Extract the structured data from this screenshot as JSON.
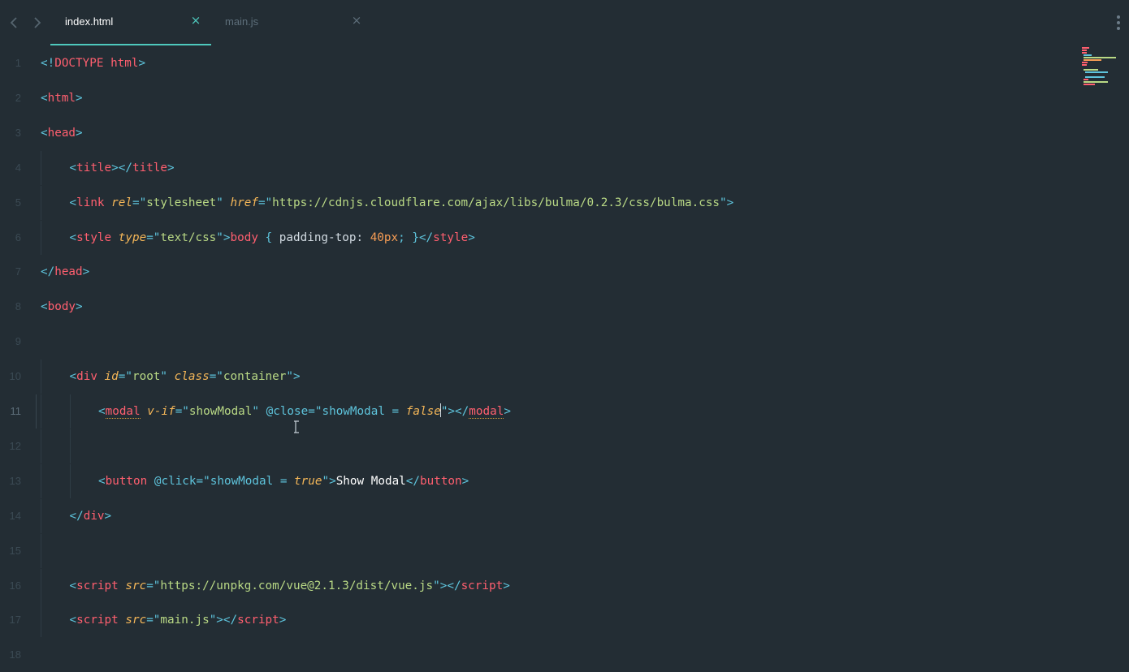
{
  "window": {
    "title": "index.html"
  },
  "tabs": [
    {
      "label": "index.html",
      "active": true,
      "close": "×"
    },
    {
      "label": "main.js",
      "active": false,
      "close": "×"
    }
  ],
  "editor": {
    "language": "html",
    "current_line": 11,
    "lines": [
      {
        "n": "1",
        "tokens": [
          [
            "pun",
            "<!"
          ],
          [
            "tag",
            "DOCTYPE html"
          ],
          [
            "pun",
            ">"
          ]
        ]
      },
      {
        "n": "2",
        "tokens": [
          [
            "pun",
            "<"
          ],
          [
            "tag",
            "html"
          ],
          [
            "pun",
            ">"
          ]
        ]
      },
      {
        "n": "3",
        "tokens": [
          [
            "pun",
            "<"
          ],
          [
            "tag",
            "head"
          ],
          [
            "pun",
            ">"
          ]
        ]
      },
      {
        "n": "4",
        "indent": 1,
        "tokens": [
          [
            "pun",
            "<"
          ],
          [
            "tag",
            "title"
          ],
          [
            "pun",
            "></"
          ],
          [
            "tag",
            "title"
          ],
          [
            "pun",
            ">"
          ]
        ]
      },
      {
        "n": "5",
        "indent": 1,
        "tokens": [
          [
            "pun",
            "<"
          ],
          [
            "tag",
            "link "
          ],
          [
            "attr",
            "rel"
          ],
          [
            "pun",
            "=\""
          ],
          [
            "str",
            "stylesheet"
          ],
          [
            "pun",
            "\" "
          ],
          [
            "attr",
            "href"
          ],
          [
            "pun",
            "=\""
          ],
          [
            "str",
            "https://cdnjs.cloudflare.com/ajax/libs/bulma/0.2.3/css/bulma.css"
          ],
          [
            "pun",
            "\">"
          ]
        ]
      },
      {
        "n": "6",
        "indent": 1,
        "tokens": [
          [
            "pun",
            "<"
          ],
          [
            "tag",
            "style "
          ],
          [
            "attr",
            "type"
          ],
          [
            "pun",
            "=\""
          ],
          [
            "str",
            "text/css"
          ],
          [
            "pun",
            "\">"
          ],
          [
            "tag",
            "body"
          ],
          [
            "pun",
            " { "
          ],
          [
            "pln",
            "padding-top: "
          ],
          [
            "num",
            "40px"
          ],
          [
            "pun",
            "; }</"
          ],
          [
            "tag",
            "style"
          ],
          [
            "pun",
            ">"
          ]
        ]
      },
      {
        "n": "7",
        "tokens": [
          [
            "pun",
            "</"
          ],
          [
            "tag",
            "head"
          ],
          [
            "pun",
            ">"
          ]
        ]
      },
      {
        "n": "8",
        "tokens": [
          [
            "pun",
            "<"
          ],
          [
            "tag",
            "body"
          ],
          [
            "pun",
            ">"
          ]
        ]
      },
      {
        "n": "9",
        "tokens": []
      },
      {
        "n": "10",
        "indent": 1,
        "tokens": [
          [
            "pun",
            "<"
          ],
          [
            "tag",
            "div "
          ],
          [
            "attr",
            "id"
          ],
          [
            "pun",
            "=\""
          ],
          [
            "str",
            "root"
          ],
          [
            "pun",
            "\" "
          ],
          [
            "attr",
            "class"
          ],
          [
            "pun",
            "=\""
          ],
          [
            "str",
            "container"
          ],
          [
            "pun",
            "\">"
          ]
        ]
      },
      {
        "n": "11",
        "indent": 2,
        "tokens": [
          [
            "pun",
            "<"
          ],
          [
            "tagw",
            "modal"
          ],
          [
            "pln",
            " "
          ],
          [
            "attr",
            "v-if"
          ],
          [
            "pun",
            "=\""
          ],
          [
            "str",
            "showModal"
          ],
          [
            "pun",
            "\" "
          ],
          [
            "ev",
            "@close"
          ],
          [
            "pun",
            "=\""
          ],
          [
            "ev",
            "showModal = "
          ],
          [
            "bool",
            "false"
          ],
          [
            "caret",
            ""
          ],
          [
            "pun",
            "\"></"
          ],
          [
            "tagw",
            "modal"
          ],
          [
            "pun",
            ">"
          ]
        ]
      },
      {
        "n": "12",
        "indent": 2,
        "tokens": []
      },
      {
        "n": "13",
        "indent": 2,
        "tokens": [
          [
            "pun",
            "<"
          ],
          [
            "tag",
            "button "
          ],
          [
            "ev",
            "@click"
          ],
          [
            "pun",
            "=\""
          ],
          [
            "ev",
            "showModal = "
          ],
          [
            "bool",
            "true"
          ],
          [
            "pun",
            "\">"
          ],
          [
            "txt",
            "Show Modal"
          ],
          [
            "pun",
            "</"
          ],
          [
            "tag",
            "button"
          ],
          [
            "pun",
            ">"
          ]
        ]
      },
      {
        "n": "14",
        "indent": 1,
        "tokens": [
          [
            "pun",
            "</"
          ],
          [
            "tag",
            "div"
          ],
          [
            "pun",
            ">"
          ]
        ]
      },
      {
        "n": "15",
        "indent": 1,
        "tokens": []
      },
      {
        "n": "16",
        "indent": 1,
        "tokens": [
          [
            "pun",
            "<"
          ],
          [
            "tag",
            "script "
          ],
          [
            "attr",
            "src"
          ],
          [
            "pun",
            "=\""
          ],
          [
            "str",
            "https://unpkg.com/vue@2.1.3/dist/vue.js"
          ],
          [
            "pun",
            "\"></"
          ],
          [
            "tag",
            "script"
          ],
          [
            "pun",
            ">"
          ]
        ]
      },
      {
        "n": "17",
        "indent": 1,
        "tokens": [
          [
            "pun",
            "<"
          ],
          [
            "tag",
            "script "
          ],
          [
            "attr",
            "src"
          ],
          [
            "pun",
            "=\""
          ],
          [
            "str",
            "main.js"
          ],
          [
            "pun",
            "\"></"
          ],
          [
            "tag",
            "script"
          ],
          [
            "pun",
            ">"
          ]
        ]
      },
      {
        "n": "18",
        "tokens": []
      }
    ]
  },
  "icons": {
    "back": "chevron-left-icon",
    "forward": "chevron-right-icon",
    "menu": "more-vertical-icon",
    "cursor": "text-cursor-icon"
  },
  "colors": {
    "background": "#232d34",
    "accent": "#4ec9bd",
    "tag": "#ff5f6f",
    "punctuation": "#5ec4dc",
    "attribute": "#f5b758",
    "string": "#b9d985",
    "number": "#f79d55"
  }
}
